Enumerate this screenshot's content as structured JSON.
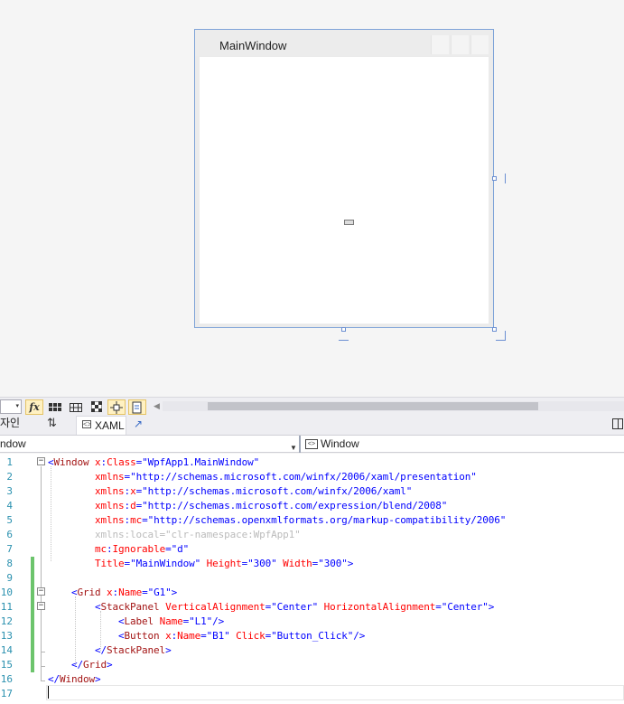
{
  "designer": {
    "window_title": "MainWindow"
  },
  "toolbar": {
    "zoom_value": "",
    "zoom_arrow": "▾",
    "fx_label": "fx",
    "buttons": [
      "fx-button",
      "grid-button",
      "snap-grid-button",
      "artboard-button",
      "snap-lines-button",
      "project-code-button"
    ],
    "scroll_left": "◀"
  },
  "tabs": {
    "design": "자인",
    "swap": "⇅",
    "xaml": "XAML",
    "popout": "↗"
  },
  "nav": {
    "left": "ndow",
    "left_arrow": "▼",
    "right_icon": "<>",
    "right": "Window"
  },
  "editor": {
    "lines": [
      {
        "num": "1",
        "tokens": [
          {
            "t": "<",
            "c": "p"
          },
          {
            "t": "Window",
            "c": "e"
          },
          {
            "t": " x",
            "c": "a"
          },
          {
            "t": ":",
            "c": "p"
          },
          {
            "t": "Class",
            "c": "a"
          },
          {
            "t": "=",
            "c": "p"
          },
          {
            "t": "\"WpfApp1.MainWindow\"",
            "c": "v"
          }
        ]
      },
      {
        "num": "2",
        "tokens": [
          {
            "t": "        xmlns",
            "c": "a"
          },
          {
            "t": "=",
            "c": "p"
          },
          {
            "t": "\"http://schemas.microsoft.com/winfx/2006/xaml/presentation\"",
            "c": "v"
          }
        ]
      },
      {
        "num": "3",
        "tokens": [
          {
            "t": "        xmlns",
            "c": "a"
          },
          {
            "t": ":",
            "c": "p"
          },
          {
            "t": "x",
            "c": "a"
          },
          {
            "t": "=",
            "c": "p"
          },
          {
            "t": "\"http://schemas.microsoft.com/winfx/2006/xaml\"",
            "c": "v"
          }
        ]
      },
      {
        "num": "4",
        "tokens": [
          {
            "t": "        xmlns",
            "c": "a"
          },
          {
            "t": ":",
            "c": "p"
          },
          {
            "t": "d",
            "c": "a"
          },
          {
            "t": "=",
            "c": "p"
          },
          {
            "t": "\"http://schemas.microsoft.com/expression/blend/2008\"",
            "c": "v"
          }
        ]
      },
      {
        "num": "5",
        "tokens": [
          {
            "t": "        xmlns",
            "c": "a"
          },
          {
            "t": ":",
            "c": "p"
          },
          {
            "t": "mc",
            "c": "a"
          },
          {
            "t": "=",
            "c": "p"
          },
          {
            "t": "\"http://schemas.openxmlformats.org/markup-compatibility/2006\"",
            "c": "v"
          }
        ]
      },
      {
        "num": "6",
        "tokens": [
          {
            "t": "        xmlns:local=\"clr-namespace:WpfApp1\"",
            "c": "d"
          }
        ]
      },
      {
        "num": "7",
        "tokens": [
          {
            "t": "        mc",
            "c": "a"
          },
          {
            "t": ":",
            "c": "p"
          },
          {
            "t": "Ignorable",
            "c": "a"
          },
          {
            "t": "=",
            "c": "p"
          },
          {
            "t": "\"d\"",
            "c": "v"
          }
        ]
      },
      {
        "num": "8",
        "tokens": [
          {
            "t": "        Title",
            "c": "a"
          },
          {
            "t": "=",
            "c": "p"
          },
          {
            "t": "\"MainWindow\"",
            "c": "v"
          },
          {
            "t": " Height",
            "c": "a"
          },
          {
            "t": "=",
            "c": "p"
          },
          {
            "t": "\"300\"",
            "c": "v"
          },
          {
            "t": " Width",
            "c": "a"
          },
          {
            "t": "=",
            "c": "p"
          },
          {
            "t": "\"300\"",
            "c": "v"
          },
          {
            "t": ">",
            "c": "p"
          }
        ]
      },
      {
        "num": "9",
        "tokens": []
      },
      {
        "num": "10",
        "tokens": [
          {
            "t": "    <",
            "c": "p"
          },
          {
            "t": "Grid",
            "c": "e"
          },
          {
            "t": " x",
            "c": "a"
          },
          {
            "t": ":",
            "c": "p"
          },
          {
            "t": "Name",
            "c": "a"
          },
          {
            "t": "=",
            "c": "p"
          },
          {
            "t": "\"G1\"",
            "c": "v"
          },
          {
            "t": ">",
            "c": "p"
          }
        ]
      },
      {
        "num": "11",
        "tokens": [
          {
            "t": "        <",
            "c": "p"
          },
          {
            "t": "StackPanel",
            "c": "e"
          },
          {
            "t": " VerticalAlignment",
            "c": "a"
          },
          {
            "t": "=",
            "c": "p"
          },
          {
            "t": "\"Center\"",
            "c": "v"
          },
          {
            "t": " HorizontalAlignment",
            "c": "a"
          },
          {
            "t": "=",
            "c": "p"
          },
          {
            "t": "\"Center\"",
            "c": "v"
          },
          {
            "t": ">",
            "c": "p"
          }
        ]
      },
      {
        "num": "12",
        "tokens": [
          {
            "t": "            <",
            "c": "p"
          },
          {
            "t": "Label",
            "c": "e"
          },
          {
            "t": " Name",
            "c": "a"
          },
          {
            "t": "=",
            "c": "p"
          },
          {
            "t": "\"L1\"",
            "c": "v"
          },
          {
            "t": "/>",
            "c": "p"
          }
        ]
      },
      {
        "num": "13",
        "tokens": [
          {
            "t": "            <",
            "c": "p"
          },
          {
            "t": "Button",
            "c": "e"
          },
          {
            "t": " x",
            "c": "a"
          },
          {
            "t": ":",
            "c": "p"
          },
          {
            "t": "Name",
            "c": "a"
          },
          {
            "t": "=",
            "c": "p"
          },
          {
            "t": "\"B1\"",
            "c": "v"
          },
          {
            "t": " Click",
            "c": "a"
          },
          {
            "t": "=",
            "c": "p"
          },
          {
            "t": "\"Button_Click\"",
            "c": "v"
          },
          {
            "t": "/>",
            "c": "p"
          }
        ]
      },
      {
        "num": "14",
        "tokens": [
          {
            "t": "        </",
            "c": "p"
          },
          {
            "t": "StackPanel",
            "c": "e"
          },
          {
            "t": ">",
            "c": "p"
          }
        ]
      },
      {
        "num": "15",
        "tokens": [
          {
            "t": "    </",
            "c": "p"
          },
          {
            "t": "Grid",
            "c": "e"
          },
          {
            "t": ">",
            "c": "p"
          }
        ]
      },
      {
        "num": "16",
        "tokens": [
          {
            "t": "</",
            "c": "p"
          },
          {
            "t": "Window",
            "c": "e"
          },
          {
            "t": ">",
            "c": "p"
          }
        ]
      },
      {
        "num": "17",
        "tokens": []
      }
    ],
    "changed_lines": [
      "8",
      "9",
      "10",
      "11",
      "12",
      "13",
      "14",
      "15"
    ],
    "colors": {
      "punct": "#0000ff",
      "element": "#a31515",
      "attribute": "#ff0000",
      "value": "#0000ff",
      "dimmed": "#bbbbbb",
      "line_number": "#2b91af",
      "change_bar": "#6cc46c"
    }
  }
}
